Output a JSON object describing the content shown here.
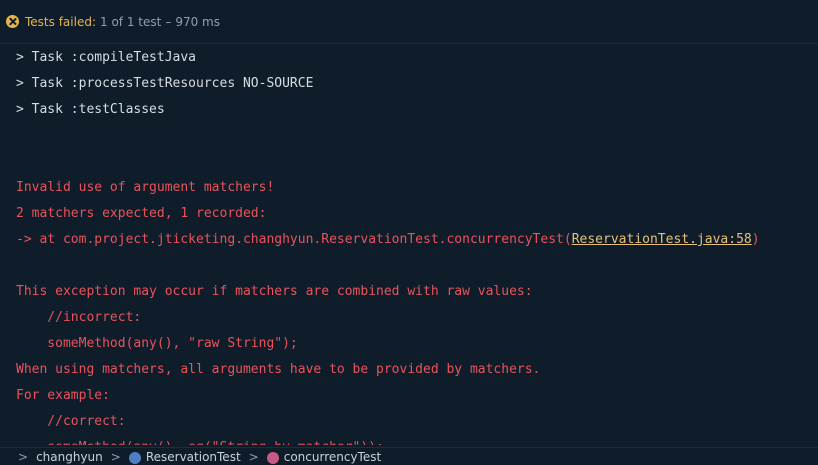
{
  "status": {
    "label": "Tests failed:",
    "count": "1 of 1 test",
    "sep": "–",
    "time": "970 ms",
    "icon": "fail-icon"
  },
  "console": {
    "gradle_lines": [
      "> Task :compileTestJava",
      "> Task :processTestResources NO-SOURCE",
      "> Task :testClasses"
    ],
    "error": {
      "title": "Invalid use of argument matchers!",
      "detail": "2 matchers expected, 1 recorded:",
      "trace_prefix": "-> at com.project.jticketing.changhyun.ReservationTest.concurrencyTest(",
      "trace_link": "ReservationTest.java:58",
      "trace_suffix": ")",
      "explain": "This exception may occur if matchers are combined with raw values:",
      "incorrect_comment": "    //incorrect:",
      "incorrect_code": "    someMethod(any(), \"raw String\");",
      "rule": "When using matchers, all arguments have to be provided by matchers.",
      "example": "For example:",
      "correct_comment": "    //correct:",
      "correct_code": "    someMethod(any(), eq(\"String by matcher\"));"
    }
  },
  "breadcrumb": {
    "package": "changhyun",
    "class": "ReservationTest",
    "method": "concurrencyTest",
    "sep": ">"
  },
  "colors": {
    "background": "#0f1d2a",
    "error": "#e9525b",
    "warning": "#e8b44a",
    "link": "#e6c07b"
  }
}
